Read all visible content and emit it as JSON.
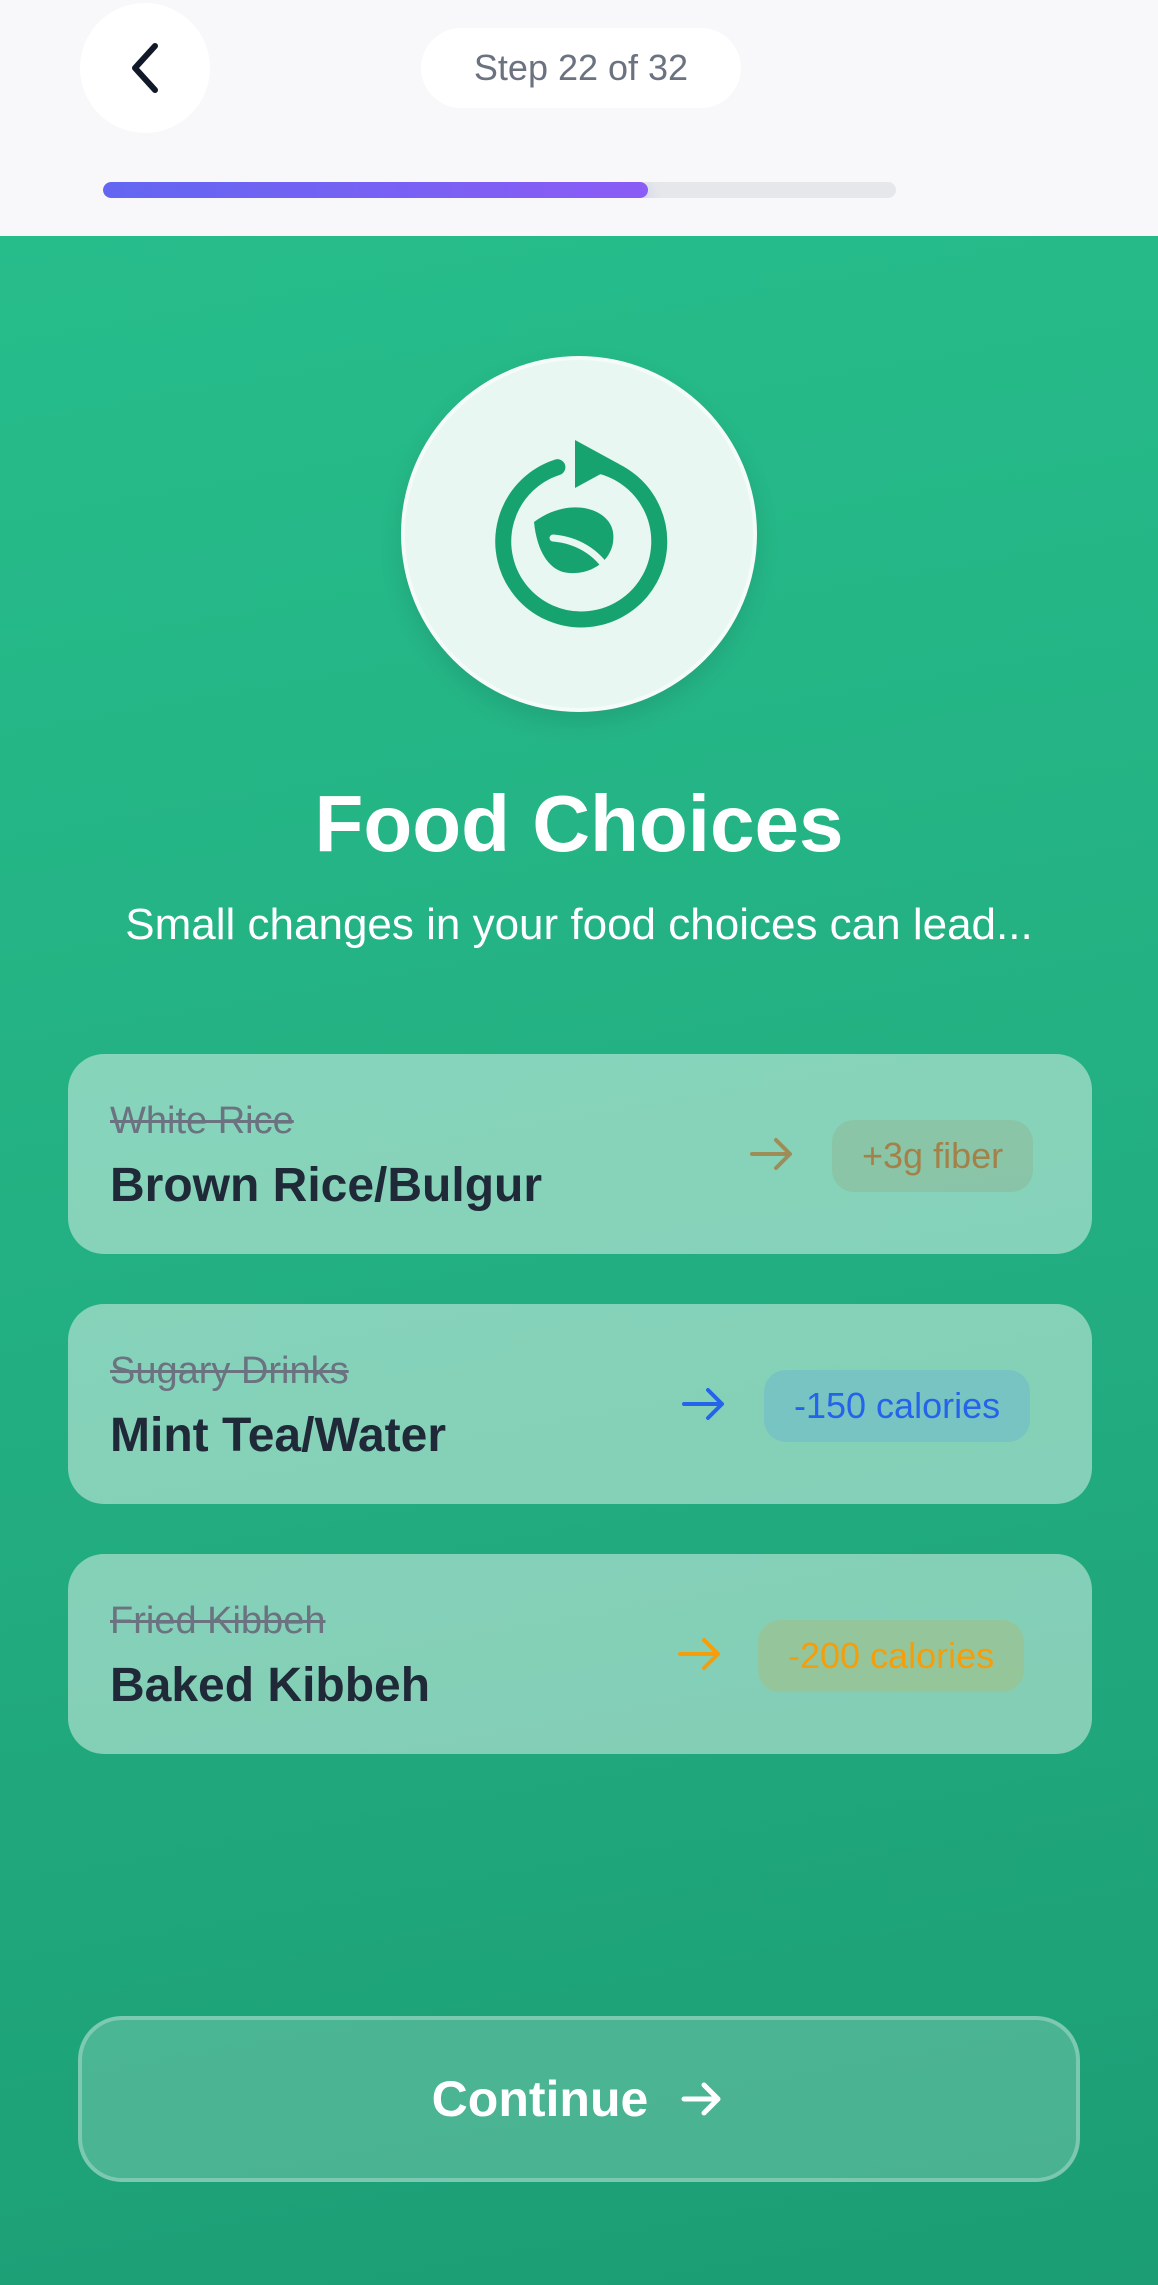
{
  "header": {
    "step_label": "Step 22 of 32",
    "progress": 0.6875
  },
  "hero": {
    "icon": "refresh-leaf-icon",
    "title": "Food Choices",
    "subtitle": "Small changes in your food choices can lead..."
  },
  "swaps": [
    {
      "old": "White Rice",
      "new": "Brown Rice/Bulgur",
      "benefit": "+3g fiber",
      "color": "#b45309"
    },
    {
      "old": "Sugary Drinks",
      "new": "Mint Tea/Water",
      "benefit": "-150 calories",
      "color": "#2563eb"
    },
    {
      "old": "Fried Kibbeh",
      "new": "Baked Kibbeh",
      "benefit": "-200 calories",
      "color": "#ea580c"
    }
  ],
  "footer": {
    "continue_label": "Continue"
  },
  "colors": {
    "accent": "#6366f1",
    "brand_green": "#22ad80"
  }
}
